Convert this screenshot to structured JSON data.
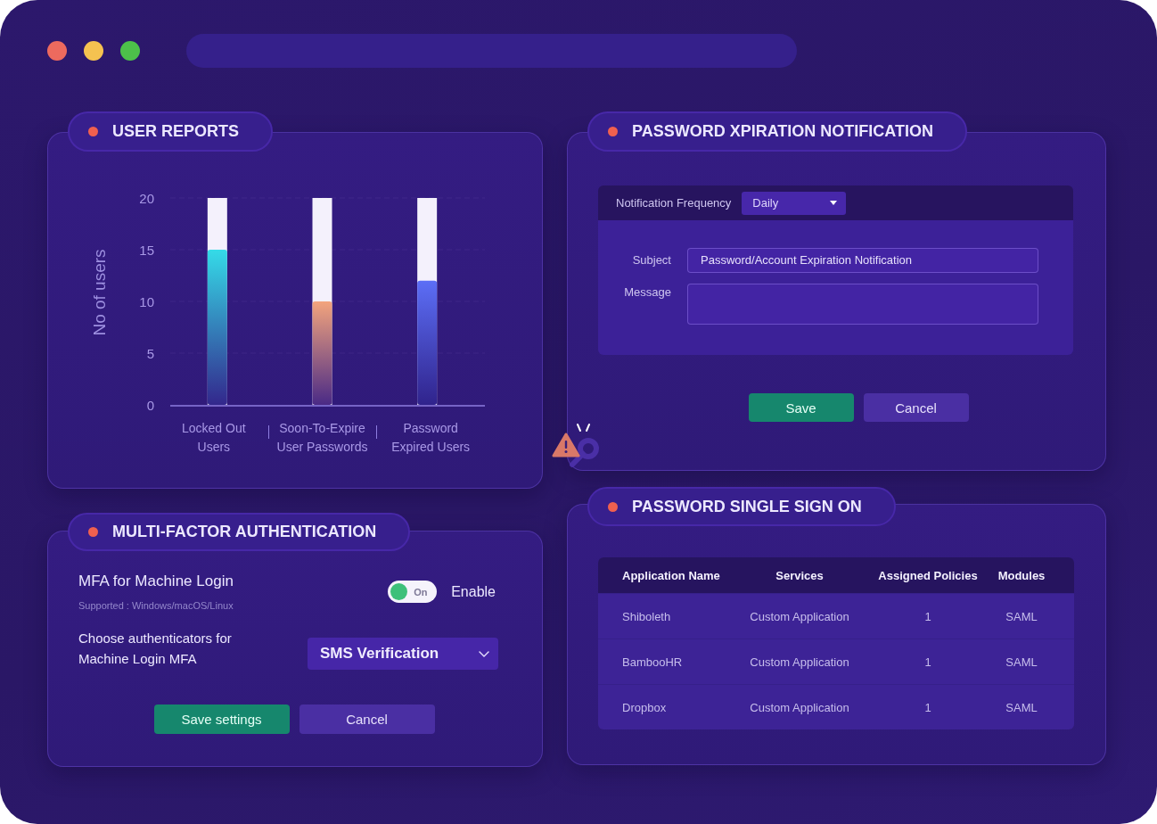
{
  "window": {
    "controls": [
      {
        "color": "#ed6a5e"
      },
      {
        "color": "#f5c250"
      },
      {
        "color": "#4dc04a"
      }
    ]
  },
  "user_reports": {
    "title": "USER REPORTS",
    "chart_data": {
      "type": "bar",
      "ylabel": "No of users",
      "categories": [
        "Locked Out\nUsers",
        "Soon-To-Expire\nUser Passwords",
        "Password\nExpired Users"
      ],
      "values": [
        15,
        10,
        12
      ],
      "ylim": [
        0,
        20
      ],
      "yticks": [
        0,
        5,
        10,
        15,
        20
      ],
      "grid": true
    }
  },
  "password_expiration": {
    "title": "PASSWORD XPIRATION NOTIFICATION",
    "frequency": {
      "label": "Notification Frequency",
      "value": "Daily"
    },
    "subject": {
      "label": "Subject",
      "value": "Password/Account Expiration Notification"
    },
    "message": {
      "label": "Message"
    },
    "buttons": [
      {
        "label": "Save",
        "kind": "primary"
      },
      {
        "label": "Cancel",
        "kind": "secondary"
      }
    ]
  },
  "mfa": {
    "title": "MULTI-FACTOR AUTHENTICATION",
    "machine_login": {
      "label": "MFA for Machine Login",
      "note": "Supported : Windows/macOS/Linux",
      "toggle": {
        "text": "On",
        "on": true
      },
      "toggle_label": "Enable"
    },
    "authenticator": {
      "label": "Choose authenticators for Machine Login MFA",
      "value": "SMS Verification"
    },
    "buttons": [
      {
        "label": "Save settings",
        "kind": "primary"
      },
      {
        "label": "Cancel",
        "kind": "secondary"
      }
    ]
  },
  "sso": {
    "title": "PASSWORD SINGLE SIGN ON",
    "table": {
      "columns": [
        "Application Name",
        "Services",
        "Assigned Policies",
        "Modules"
      ],
      "rows": [
        [
          "Shiboleth",
          "Custom Application",
          "1",
          "SAML"
        ],
        [
          "BambooHR",
          "Custom Application",
          "1",
          "SAML"
        ],
        [
          "Dropbox",
          "Custom Application",
          "1",
          "SAML"
        ]
      ]
    }
  }
}
